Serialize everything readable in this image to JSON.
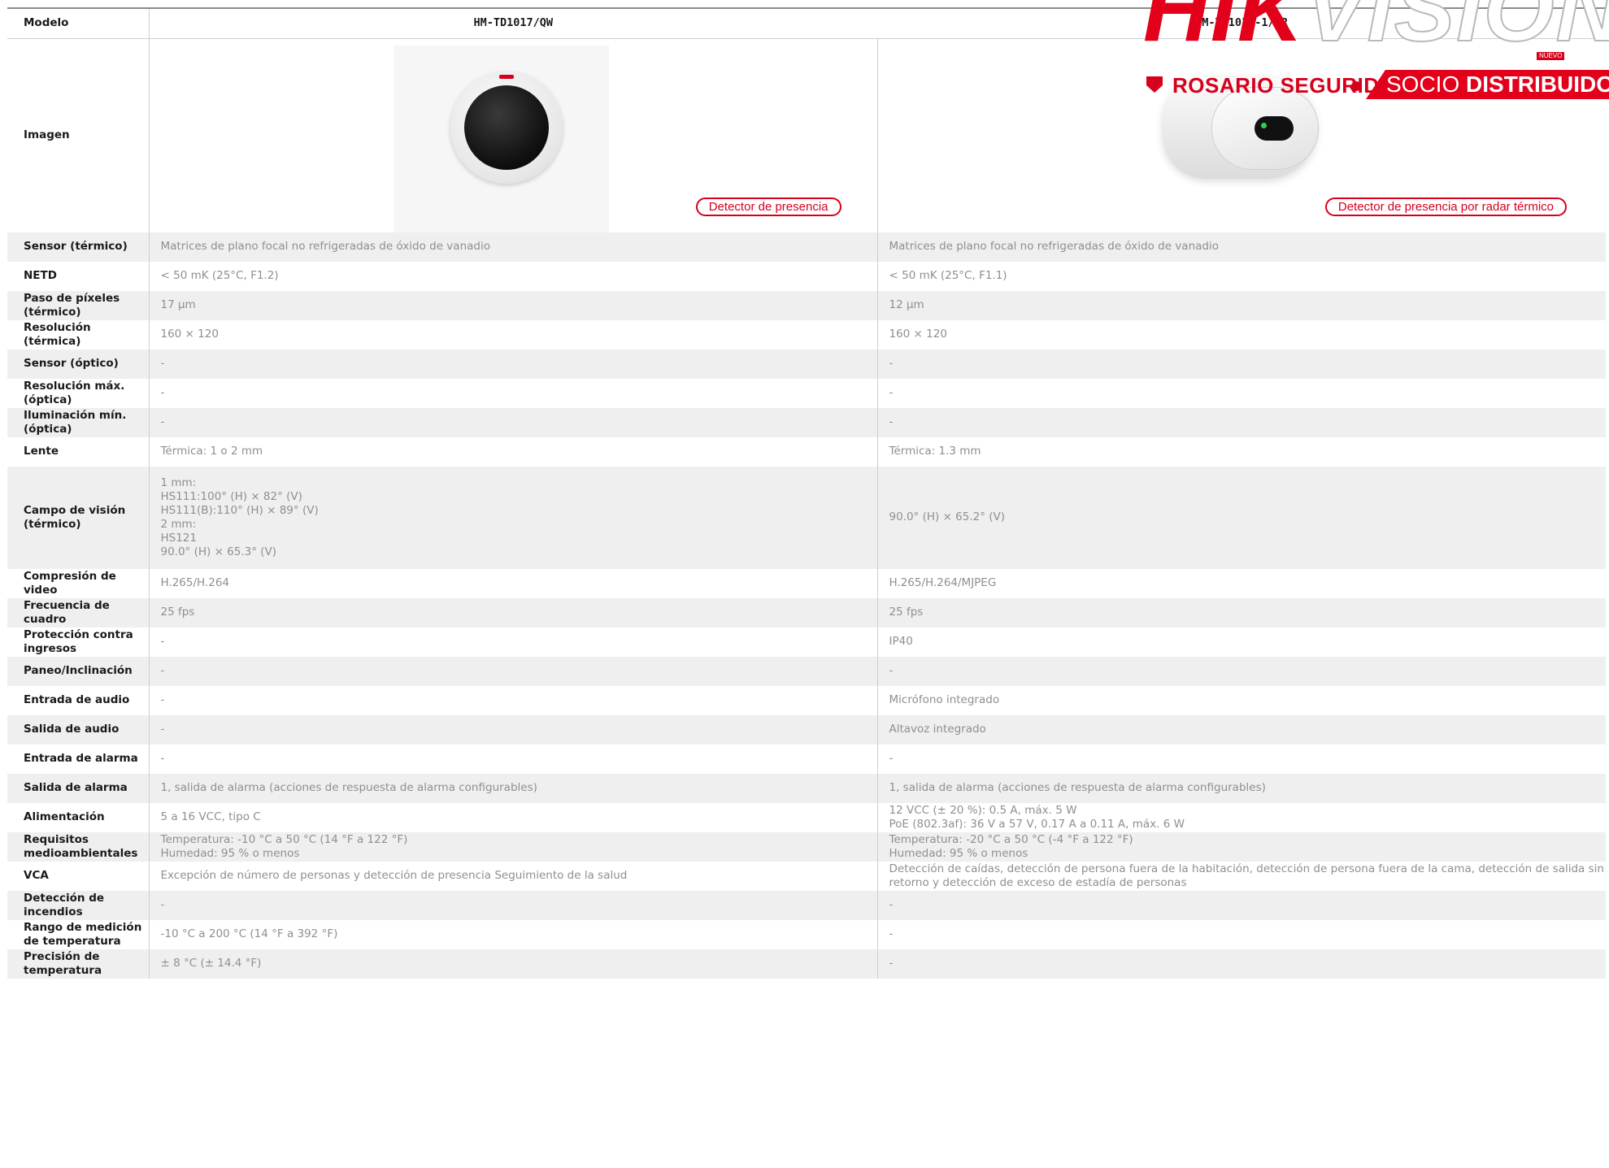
{
  "logo": {
    "brand_red": "HIK",
    "brand_white": "VISION",
    "badge": "NUEVO",
    "dealer": "ROSARIO SEGURIDAD",
    "partner_1": "SOCIO",
    "partner_2": "DISTRIBUIDOR"
  },
  "header": {
    "label": "Modelo",
    "model_1": "HM-TD1017/QW",
    "model_2": "HM-TD1018-1/QR"
  },
  "image_row": {
    "label": "Imagen",
    "caption_1": "Detector de presencia",
    "caption_2": "Detector de presencia por radar térmico"
  },
  "rows": [
    {
      "label": "Sensor (térmico)",
      "v1": "Matrices de plano focal no refrigeradas de óxido de vanadio",
      "v2": "Matrices de plano focal no refrigeradas de óxido de vanadio"
    },
    {
      "label": "NETD",
      "v1": "< 50 mK (25°C, F1.2)",
      "v2": "< 50 mK (25°C, F1.1)"
    },
    {
      "label": "Paso de píxeles (térmico)",
      "v1": "17 μm",
      "v2": "12 μm"
    },
    {
      "label": "Resolución (térmica)",
      "v1": "160 × 120",
      "v2": "160 × 120"
    },
    {
      "label": "Sensor (óptico)",
      "v1": "-",
      "v2": "-"
    },
    {
      "label": "Resolución máx. (óptica)",
      "v1": "-",
      "v2": "-"
    },
    {
      "label": "Iluminación mín. (óptica)",
      "v1": "-",
      "v2": "-"
    },
    {
      "label": "Lente",
      "v1": "Térmica: 1 o 2 mm",
      "v2": "Térmica: 1.3 mm"
    },
    {
      "label": "Campo de visión (térmico)",
      "v1": "1 mm:\nHS111:100° (H) × 82° (V)\nHS111(B):110° (H) × 89° (V)\n2 mm:\nHS121\n90.0° (H) × 65.3° (V)",
      "v2": "90.0° (H) × 65.2° (V)"
    },
    {
      "label": "Compresión de video",
      "v1": "H.265/H.264",
      "v2": "H.265/H.264/MJPEG"
    },
    {
      "label": "Frecuencia de cuadro",
      "v1": "25 fps",
      "v2": "25 fps"
    },
    {
      "label": "Protección contra ingresos",
      "v1": "-",
      "v2": "IP40"
    },
    {
      "label": "Paneo/Inclinación",
      "v1": "-",
      "v2": "-"
    },
    {
      "label": "Entrada de audio",
      "v1": "-",
      "v2": "Micrófono integrado"
    },
    {
      "label": "Salida de audio",
      "v1": "-",
      "v2": "Altavoz integrado"
    },
    {
      "label": "Entrada de alarma",
      "v1": "-",
      "v2": "-"
    },
    {
      "label": "Salida de alarma",
      "v1": "1, salida de alarma (acciones de respuesta de alarma configurables)",
      "v2": "1, salida de alarma (acciones de respuesta de alarma configurables)"
    },
    {
      "label": "Alimentación",
      "v1": "5 a 16 VCC, tipo C",
      "v2": "12 VCC (± 20 %): 0.5 A, máx. 5 W\nPoE (802.3af): 36 V a 57 V, 0.17 A a 0.11 A, máx. 6 W"
    },
    {
      "label": "Requisitos medioambientales",
      "v1": "Temperatura: -10 °C a 50 °C (14 °F a 122 °F)\nHumedad: 95 % o menos",
      "v2": "Temperatura: -20 °C a 50 °C (-4 °F a 122 °F)\nHumedad: 95 % o menos"
    },
    {
      "label": "VCA",
      "v1": "Excepción de número de personas y detección de presencia Seguimiento de la salud",
      "v2": "Detección de caídas, detección de persona fuera de la habitación, detección de persona fuera de la cama, detección de salida sin retorno y detección de exceso de estadía de personas"
    },
    {
      "label": "Detección de incendios",
      "v1": "-",
      "v2": "-"
    },
    {
      "label": "Rango de medición de temperatura",
      "v1": "-10 °C a 200 °C (14 °F a 392 °F)",
      "v2": "-"
    },
    {
      "label": "Precisión de temperatura",
      "v1": "± 8 °C (± 14.4 °F)",
      "v2": "-"
    }
  ]
}
